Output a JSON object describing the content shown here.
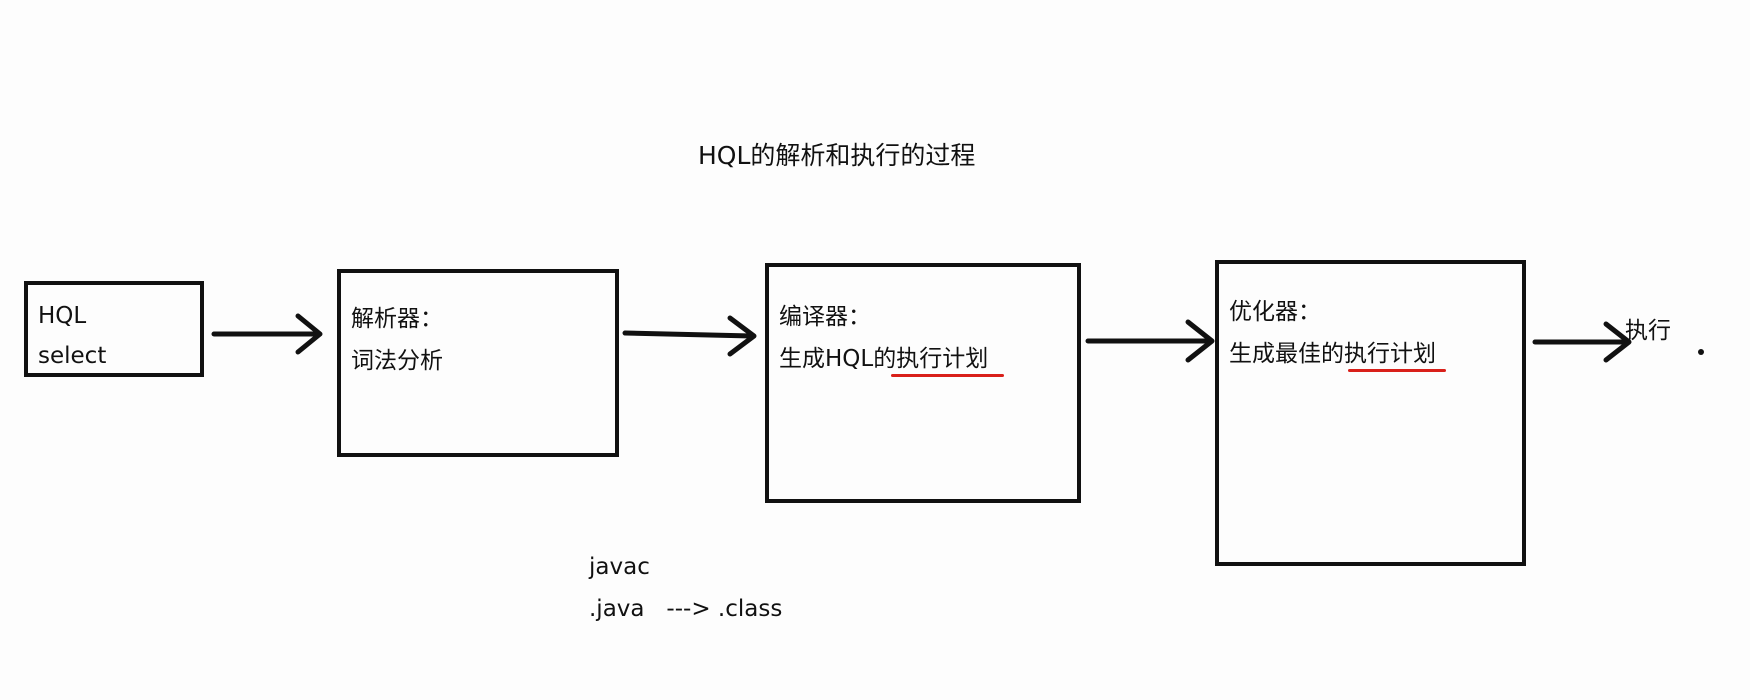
{
  "title": "HQL的解析和执行的过程",
  "boxes": [
    {
      "line1": "HQL",
      "line2": "select"
    },
    {
      "line1": "解析器：",
      "line2": "词法分析"
    },
    {
      "line1": "编译器：",
      "line2": "生成HQL的执行计划"
    },
    {
      "line1": "优化器：",
      "line2": "生成最佳的执行计划"
    }
  ],
  "final_label": "执行",
  "note": {
    "line1": "javac",
    "line2": ".java   ---> .class"
  },
  "colors": {
    "stroke": "#111111",
    "highlight": "#d9201a",
    "background": "#fdfdfd"
  }
}
